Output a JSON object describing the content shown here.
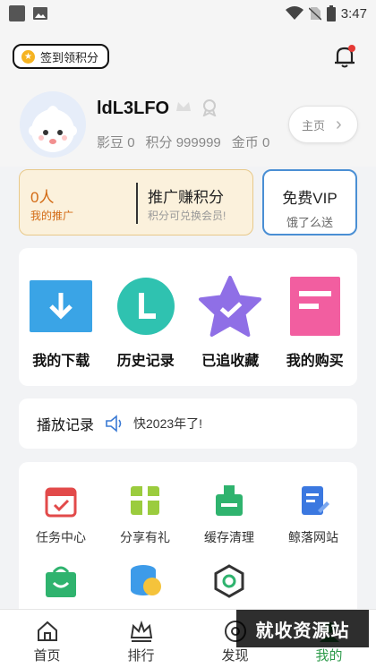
{
  "status_bar": {
    "time": "3:47"
  },
  "header": {
    "signin_label": "签到领积分"
  },
  "profile": {
    "username": "ldL3LFO",
    "stats": [
      {
        "label": "影豆",
        "value": "0"
      },
      {
        "label": "积分",
        "value": "999999"
      },
      {
        "label": "金币",
        "value": "0"
      }
    ],
    "home_button": "主页"
  },
  "promo": {
    "count": "0人",
    "count_label": "我的推广",
    "title": "推广赚积分",
    "subtitle": "积分可兑换会员!"
  },
  "vip": {
    "title": "免费VIP",
    "subtitle": "饿了么送"
  },
  "quick_actions": [
    {
      "label": "我的下载",
      "icon": "download-icon",
      "color": "#3aa4e6"
    },
    {
      "label": "历史记录",
      "icon": "history-icon",
      "color": "#2fc2b0"
    },
    {
      "label": "已追收藏",
      "icon": "favorite-star-icon",
      "color": "#8f6fe6"
    },
    {
      "label": "我的购买",
      "icon": "purchase-icon",
      "color": "#f25ea0"
    }
  ],
  "history": {
    "title": "播放记录",
    "message": "快2023年了!"
  },
  "services": [
    {
      "label": "任务中心",
      "icon": "task-icon"
    },
    {
      "label": "分享有礼",
      "icon": "gift-icon"
    },
    {
      "label": "缓存清理",
      "icon": "clean-icon"
    },
    {
      "label": "鲸落网站",
      "icon": "website-icon"
    },
    {
      "label": "",
      "icon": "shop-bag-icon"
    },
    {
      "label": "",
      "icon": "coins-icon"
    },
    {
      "label": "",
      "icon": "settings-hex-icon"
    }
  ],
  "tabs": [
    {
      "label": "首页",
      "icon": "home-icon"
    },
    {
      "label": "排行",
      "icon": "crown-icon"
    },
    {
      "label": "发现",
      "icon": "discover-icon"
    },
    {
      "label": "我的",
      "icon": "profile-icon"
    }
  ],
  "watermark": "就收资源站",
  "colors": {
    "accent": "#2e9b4b",
    "promo_text": "#d36b15",
    "vip_border": "#4a8fd4"
  }
}
